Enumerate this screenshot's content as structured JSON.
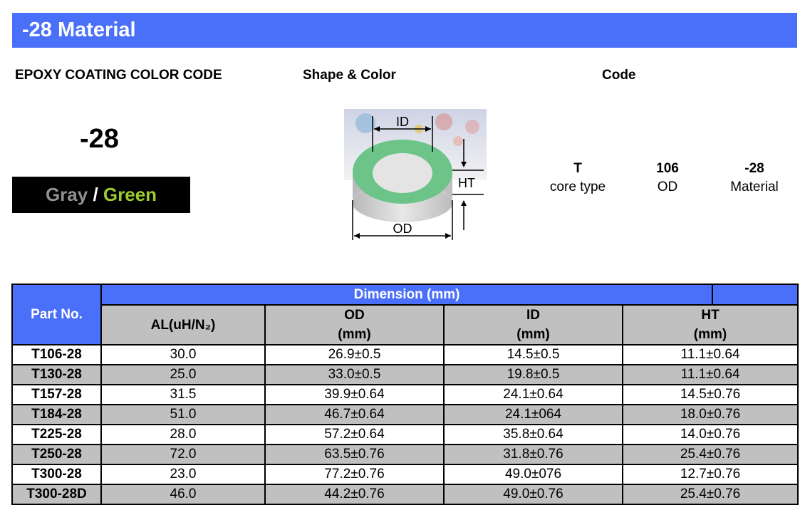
{
  "title": "-28 Material",
  "headers": {
    "epoxy": "EPOXY COATING COLOR CODE",
    "shape": "Shape & Color",
    "code": "Code"
  },
  "material_code": "-28",
  "color_code": {
    "gray": "Gray",
    "slash": " / ",
    "green": "Green"
  },
  "diagram": {
    "id": "ID",
    "ht": "HT",
    "od": "OD"
  },
  "code_breakdown": [
    {
      "value": "T",
      "label": "core type"
    },
    {
      "value": "106",
      "label": "OD"
    },
    {
      "value": "-28",
      "label": "Material"
    }
  ],
  "table": {
    "part_no_header": "Part No.",
    "dimension_header": "Dimension (mm)",
    "al_header": "AL(uH/N₂)",
    "od_header": "OD",
    "id_header": "ID",
    "ht_header": "HT",
    "unit": "(mm)",
    "rows": [
      {
        "part": "T106-28",
        "al": "30.0",
        "od": "26.9±0.5",
        "id": "14.5±0.5",
        "ht": "11.1±0.64"
      },
      {
        "part": "T130-28",
        "al": "25.0",
        "od": "33.0±0.5",
        "id": "19.8±0.5",
        "ht": "11.1±0.64"
      },
      {
        "part": "T157-28",
        "al": "31.5",
        "od": "39.9±0.64",
        "id": "24.1±0.64",
        "ht": "14.5±0.76"
      },
      {
        "part": "T184-28",
        "al": "51.0",
        "od": "46.7±0.64",
        "id": "24.1±064",
        "ht": "18.0±0.76"
      },
      {
        "part": "T225-28",
        "al": "28.0",
        "od": "57.2±0.64",
        "id": "35.8±0.64",
        "ht": "14.0±0.76"
      },
      {
        "part": "T250-28",
        "al": "72.0",
        "od": "63.5±0.76",
        "id": "31.8±0.76",
        "ht": "25.4±0.76"
      },
      {
        "part": "T300-28",
        "al": "23.0",
        "od": "77.2±0.76",
        "id": "49.0±076",
        "ht": "12.7±0.76"
      },
      {
        "part": "T300-28D",
        "al": "46.0",
        "od": "44.2±0.76",
        "id": "49.0±0.76",
        "ht": "25.4±0.76"
      }
    ]
  },
  "colors": {
    "header_blue": "#4a6ff8",
    "row_gray": "#c0c0c0",
    "coat_green": "#6cc488",
    "label_green": "#9ccc2c"
  }
}
